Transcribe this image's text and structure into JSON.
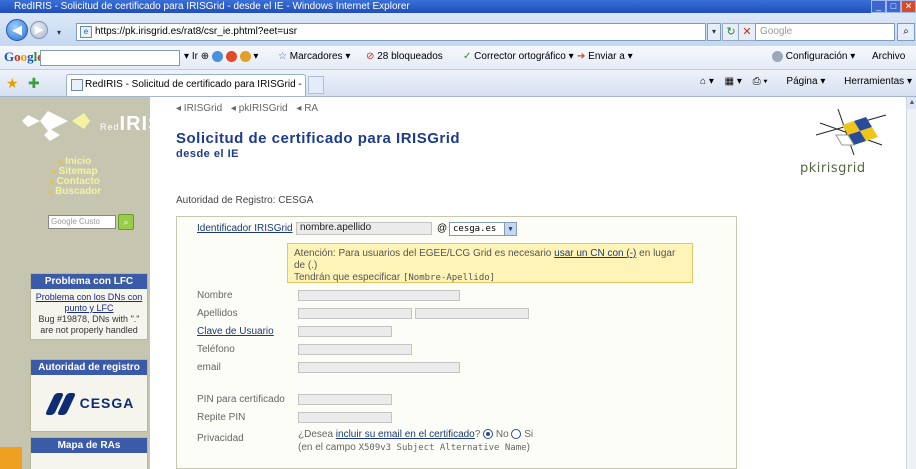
{
  "window": {
    "title": "RedIRIS - Solicitud de certificado para IRISGrid - desde el IE - Windows Internet Explorer"
  },
  "address": {
    "url": "https://pk.irisgrid.es/rat8/csr_ie.phtml?eet=usr",
    "search_placeholder": "Google"
  },
  "gtoolbar": {
    "logo": "Google",
    "items": [
      "Ir",
      "Marcadores",
      "28 bloqueados",
      "Corrector ortográfico",
      "Enviar a"
    ],
    "right": [
      "Configuración",
      "Archivo"
    ]
  },
  "tab": {
    "label": "RedIRIS - Solicitud de certificado para IRISGrid - desd...",
    "commands": [
      "Página",
      "Herramientas"
    ]
  },
  "sidebar": {
    "logo_text": "IRIS",
    "logo_small": "Red",
    "nav": [
      "Inicio",
      "Sitemap",
      "Contacto",
      "Buscador"
    ],
    "search_placeholder": "Google Custo",
    "lfc": {
      "title": "Problema con LFC",
      "link": "Problema con los DNs con punto y LFC",
      "text": "Bug #19878, DNs with \".\" are not properly handled"
    },
    "authority": {
      "title": "Autoridad de registro",
      "logo": "CESGA"
    },
    "map": {
      "title": "Mapa de RAs"
    }
  },
  "main": {
    "breadcrumb": [
      "◂ IRISGrid",
      "◂ pkIRISGrid",
      "◂ RA"
    ],
    "title": "Solicitud de certificado para IRISGrid",
    "subtitle": "desde el IE",
    "pki_logo": "pkirisgrid",
    "authority": "Autoridad de Registro: CESGA"
  },
  "form": {
    "identifier_label": "Identificador IRISGrid",
    "identifier_value": "nombre.apellido",
    "at": "@",
    "domain": "cesga.es",
    "warning": {
      "prefix": "Atención: Para usuarios del EGEE/LCG Grid es necesario ",
      "link": "usar un CN con (-)",
      "suffix": " en lugar de (.)",
      "line2_prefix": "Tendrán que especificar ",
      "line2_code": "[Nombre-Apellido]"
    },
    "labels": {
      "nombre": "Nombre",
      "apellidos": "Apellidos",
      "clave": "Clave de Usuario",
      "telefono": "Teléfono",
      "email": "email",
      "pin": "PIN para certificado",
      "repite_pin": "Repite PIN",
      "privacidad": "Privacidad"
    },
    "privacy": {
      "question_prefix": "¿Desea ",
      "question_link": "incluir su email en el certificado",
      "question_suffix": "?",
      "no": "No",
      "si": "Si",
      "selected": "No",
      "note_prefix": "(en el campo ",
      "note_code": "X509v3 Subject Alternative Name",
      "note_suffix": ")"
    }
  }
}
